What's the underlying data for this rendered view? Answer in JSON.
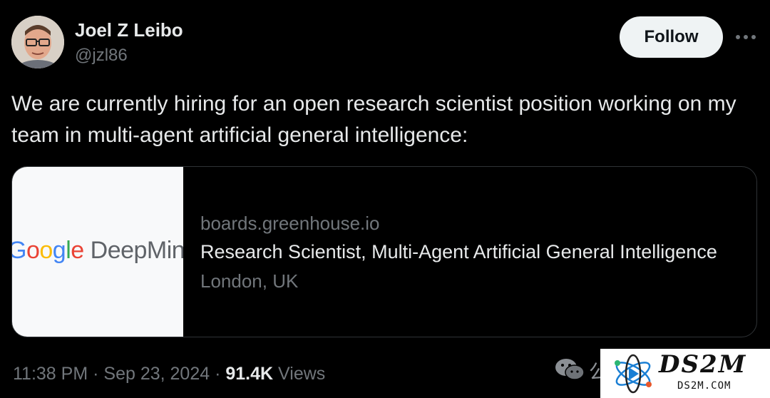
{
  "author": {
    "name": "Joel Z Leibo",
    "handle": "@jzl86"
  },
  "follow_button": {
    "label": "Follow"
  },
  "more_icon": "more-horizontal-icon",
  "tweet": {
    "text": "We are currently hiring for an open research scientist position working on my team in multi-agent artificial general intelligence:"
  },
  "link_card": {
    "thumbnail_logo_text": "Google DeepMind",
    "domain": "boards.greenhouse.io",
    "title": "Research Scientist, Multi-Agent Artificial General Intelligence",
    "location": "London, UK"
  },
  "meta": {
    "time": "11:38 PM",
    "separator": "·",
    "date": "Sep 23, 2024",
    "views_count": "91.4K",
    "views_label": "Views"
  },
  "watermark": {
    "partial_text": "公",
    "brand": "DS2M",
    "url": "DS2M.COM"
  },
  "colors": {
    "background": "#000000",
    "primary_text": "#e7e9ea",
    "secondary_text": "#71767b",
    "follow_bg": "#eff3f4",
    "card_border": "#2f3336"
  }
}
